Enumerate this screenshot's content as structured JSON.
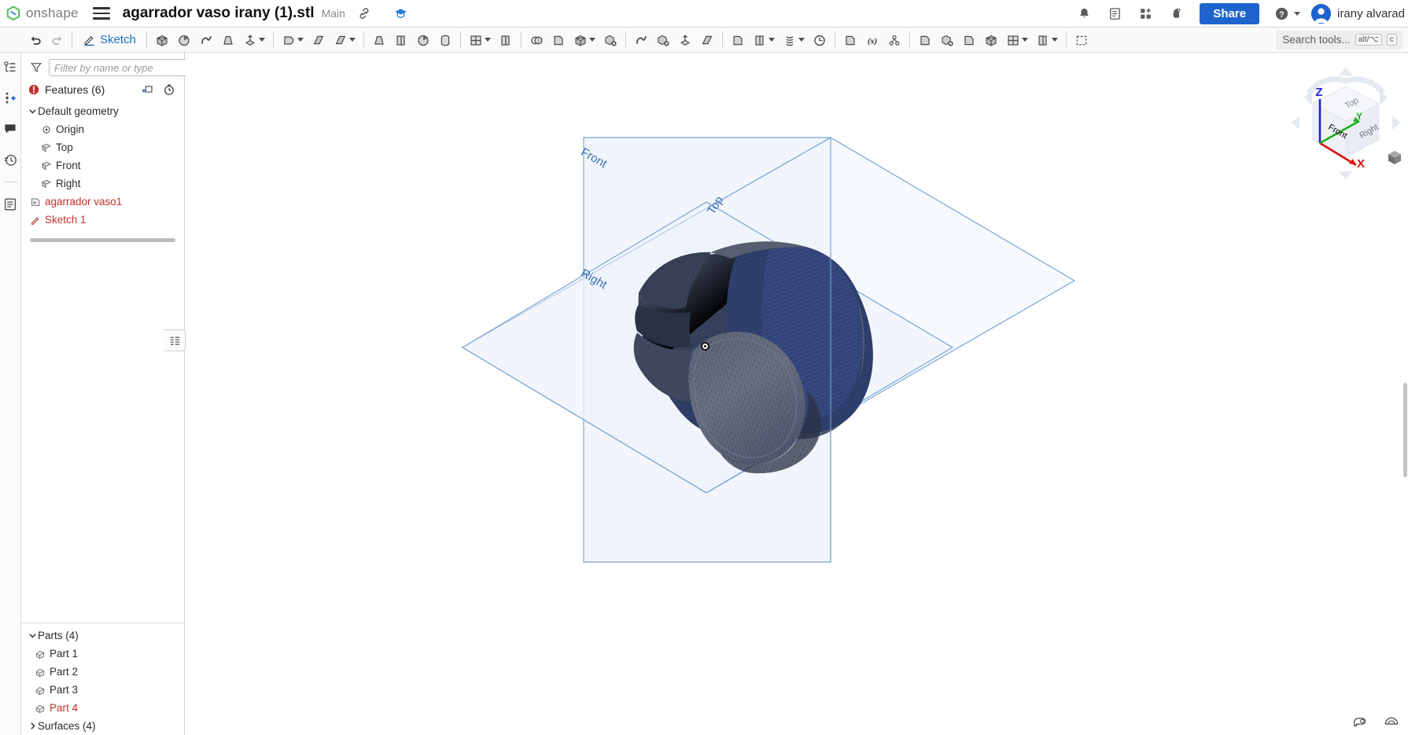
{
  "header": {
    "logo_text": "onshape",
    "logo_icon": "onshape-logo-icon",
    "menu_icon": "hamburger-menu-icon",
    "document_title": "agarrador vaso irany (1).stl",
    "branch": "Main",
    "link_icon": "link-icon",
    "learning_icon": "learning-center-icon",
    "notifications_icon": "bell-icon",
    "tasks_icon": "tasks-list-icon",
    "apps_icon": "apps-grid-add-icon",
    "ai_icon": "ai-assistant-icon",
    "share_label": "Share",
    "help_icon": "help-question-icon",
    "help_caret_icon": "chevron-down-icon",
    "avatar_icon": "user-avatar-icon",
    "user_name": "irany alvarad"
  },
  "toolbar": {
    "undo_icon": "undo-arrow-icon",
    "redo_icon": "redo-arrow-icon",
    "sketch_label": "Sketch",
    "sketch_icon": "sketch-pencil-icon",
    "tools": [
      {
        "name": "extrude-icon"
      },
      {
        "name": "revolve-icon"
      },
      {
        "name": "sweep-icon"
      },
      {
        "name": "loft-icon"
      },
      {
        "name": "thicken-icon",
        "caret": true
      },
      {
        "name": "fillet-icon",
        "caret": true
      },
      {
        "name": "chamfer-icon"
      },
      {
        "name": "draft-icon",
        "caret": true
      },
      {
        "name": "shell-icon"
      },
      {
        "name": "rib-icon"
      },
      {
        "name": "hole-icon"
      },
      {
        "name": "thread-icon"
      },
      {
        "name": "pattern-icon",
        "caret": true
      },
      {
        "name": "mirror-icon"
      },
      {
        "name": "boolean-icon"
      },
      {
        "name": "split-icon"
      },
      {
        "name": "transform-icon",
        "caret": true
      },
      {
        "name": "delete-part-icon"
      },
      {
        "name": "move-face-icon"
      },
      {
        "name": "delete-face-icon"
      },
      {
        "name": "replace-face-icon"
      },
      {
        "name": "enclose-icon"
      },
      {
        "name": "plane-icon"
      },
      {
        "name": "sheet-metal-icon",
        "caret": true
      },
      {
        "name": "curve-icon",
        "caret": true
      },
      {
        "name": "helix-icon"
      },
      {
        "name": "import-derived-icon"
      },
      {
        "name": "variable-icon"
      },
      {
        "name": "assembly-icon"
      },
      {
        "name": "surface-extrude-icon"
      },
      {
        "name": "delete-body-icon"
      },
      {
        "name": "surface-fill-icon"
      },
      {
        "name": "surface-offset-icon"
      },
      {
        "name": "surface-pattern-icon",
        "caret": true
      },
      {
        "name": "composite-part-icon",
        "caret": true
      },
      {
        "name": "bounding-box-icon"
      }
    ],
    "search_placeholder": "Search tools...",
    "search_kbd_alt": "alt/⌥",
    "search_kbd_key": "c",
    "search_icon": "search-icon"
  },
  "rail": {
    "items": [
      {
        "name": "feature-list-icon"
      },
      {
        "name": "add-version-icon"
      },
      {
        "name": "comments-icon"
      },
      {
        "name": "history-clock-icon"
      },
      {
        "name": "properties-list-icon"
      }
    ]
  },
  "tree": {
    "filter_placeholder": "Filter by name or type",
    "filter_icon": "filter-funnel-icon",
    "filter_value": "",
    "features_label": "Features (6)",
    "features_error_icon": "error-alert-icon",
    "add-folder_icon": "add-folder-icon",
    "rollback_icon": "rollback-timer-icon",
    "items": [
      {
        "label": "Default geometry",
        "icon": "chevron-down-icon",
        "type": "group",
        "error": false
      },
      {
        "label": "Origin",
        "icon": "origin-point-icon",
        "type": "child",
        "error": false
      },
      {
        "label": "Top",
        "icon": "plane-icon",
        "type": "child",
        "error": false
      },
      {
        "label": "Front",
        "icon": "plane-icon",
        "type": "child",
        "error": false
      },
      {
        "label": "Right",
        "icon": "plane-icon",
        "type": "child",
        "error": false
      },
      {
        "label": "agarrador vaso1",
        "icon": "imported-mesh-icon",
        "type": "feature",
        "error": true
      },
      {
        "label": "Sketch 1",
        "icon": "sketch-pencil-icon",
        "type": "feature",
        "error": true
      }
    ],
    "parts_label": "Parts (4)",
    "parts_chevron_icon": "chevron-down-icon",
    "parts": [
      {
        "label": "Part 1",
        "icon": "part-body-icon",
        "error": false
      },
      {
        "label": "Part 2",
        "icon": "part-body-icon",
        "error": false
      },
      {
        "label": "Part 3",
        "icon": "part-body-icon",
        "error": false
      },
      {
        "label": "Part 4",
        "icon": "part-body-icon",
        "error": true
      }
    ],
    "surfaces_label": "Surfaces (4)",
    "surfaces_chevron_icon": "chevron-right-icon"
  },
  "panel_toggle": {
    "icon": "panel-collapse-icon"
  },
  "viewport": {
    "plane_front_label": "Front",
    "plane_top_label": "Top",
    "plane_right_label": "Right",
    "origin_marker_icon": "origin-marker-icon",
    "model_name": "agarrador-vaso-mesh"
  },
  "viewcube": {
    "face_top": "Top",
    "face_front": "Front",
    "face_right": "Right",
    "axis_z": "Z",
    "axis_y": "Y",
    "axis_x": "X",
    "home_icon": "view-home-cube-icon",
    "axis_z_color": "#2020d8",
    "axis_y_color": "#18b218",
    "axis_x_color": "#e01010"
  },
  "bottom_tools": [
    {
      "name": "measure-tape-icon"
    },
    {
      "name": "protractor-icon"
    }
  ],
  "colors": {
    "accent_blue": "#1f64cc",
    "error_red": "#c2302a",
    "plane_blue": "#3b6fb8",
    "mesh_dark": "#3d4a63"
  }
}
